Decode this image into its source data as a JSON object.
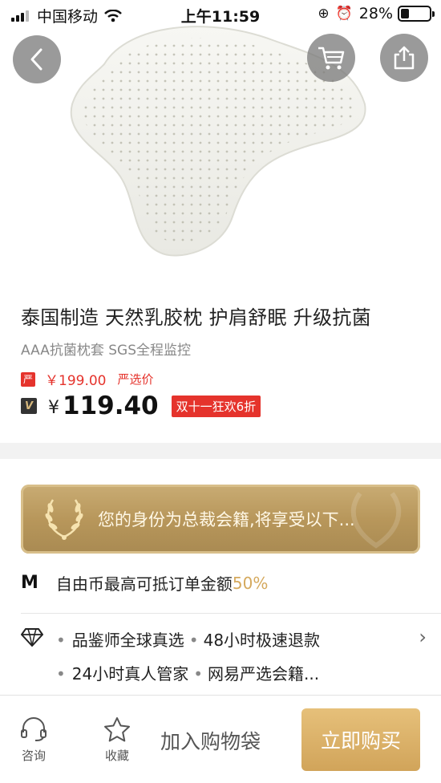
{
  "status_bar": {
    "carrier": "中国移动",
    "time": "上午11:59",
    "battery_percent": "28%",
    "battery_level": 0.28
  },
  "nav": {
    "back_icon": "chevron-left-icon",
    "cart_icon": "cart-icon",
    "share_icon": "share-icon"
  },
  "product": {
    "title": "泰国制造 天然乳胶枕 护肩舒眠 升级抗菌",
    "subtitle": "AAA抗菌枕套 SGS全程监控",
    "original_badge": "严",
    "original_price": "￥199.00",
    "original_tag": "严选价",
    "vip_badge": "V",
    "currency": "¥",
    "vip_price": "119.40",
    "promo_tag": "双十一狂欢6折"
  },
  "membership": {
    "banner_text": "您的身份为总裁会籍,将享受以下...",
    "coin_icon": "M",
    "coin_text": "自由币最高可抵订单金额",
    "coin_percent": "50%",
    "services_line1": [
      "品鉴师全球真选",
      "48小时极速退款"
    ],
    "services_line2": [
      "24小时真人管家",
      "网易严选会籍..."
    ]
  },
  "bottom_bar": {
    "consult_label": "咨询",
    "favorite_label": "收藏",
    "add_to_cart_label": "加入购物袋",
    "buy_now_label": "立即购买"
  },
  "colors": {
    "accent_red": "#e5332c",
    "gold": "#d1a45a"
  }
}
